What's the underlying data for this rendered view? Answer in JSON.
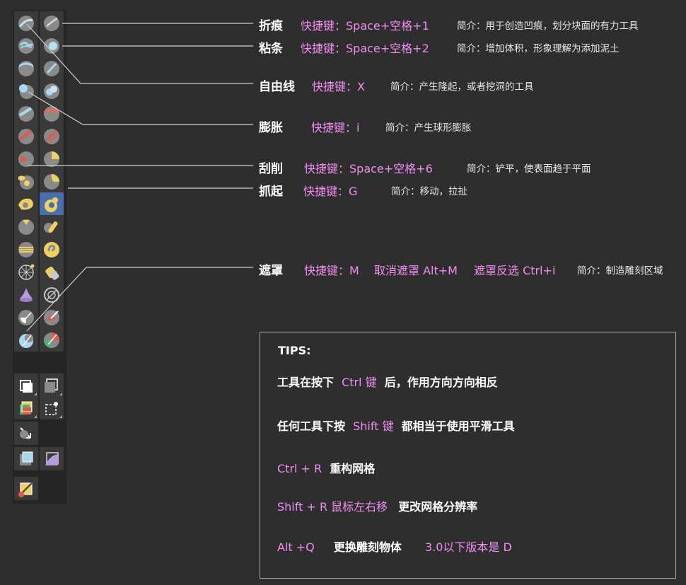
{
  "tools": [
    {
      "name": "折痕",
      "shortcut": "快捷键：Space+空格+1",
      "desc": "简介：用于创造凹痕，划分块面的有力工具"
    },
    {
      "name": "粘条",
      "shortcut": "快捷键：Space+空格+2",
      "desc": "简介：增加体积，形象理解为添加泥土"
    },
    {
      "name": "自由线",
      "shortcut": "快捷键：X",
      "desc": "简介：产生隆起，或者挖洞的工具"
    },
    {
      "name": "膨胀",
      "shortcut": "快捷键：i",
      "desc": "简介：产生球形膨胀"
    },
    {
      "name": "刮削",
      "shortcut": "快捷键：Space+空格+6",
      "desc": "简介：铲平，使表面趋于平面"
    },
    {
      "name": "抓起",
      "shortcut": "快捷键：G",
      "desc": "简介：移动，拉扯"
    },
    {
      "name": "遮罩",
      "shortcut": "快捷键：M",
      "shortcut2": "取消遮罩 Alt+M",
      "shortcut3": "遮罩反选 Ctrl+i",
      "desc": "简介：制造雕刻区域"
    }
  ],
  "tips": {
    "title": "TIPS:",
    "tip1": {
      "a": "工具在按下",
      "b": "Ctrl 键",
      "c": "后，作用方向方向相反"
    },
    "tip2": {
      "a": "任何工具下按",
      "b": "Shift 键",
      "c": "都相当于使用平滑工具"
    },
    "tip3": {
      "a": "Ctrl + R",
      "b": "重构网格"
    },
    "tip4": {
      "a": "Shift + R 鼠标左右移",
      "b": "更改网格分辨率"
    },
    "tip5": {
      "a": "Alt +Q",
      "b": "更换雕刻物体",
      "c": "3.0以下版本是  D"
    }
  },
  "colors": {
    "background": "#2e2e2e",
    "palette": "#252525",
    "button": "#3a3a3a",
    "active_button": "#4a6fb0",
    "accent_pink": "#f08ef0",
    "text": "#ffffff"
  },
  "icons": [
    "crease-brush-icon",
    "blob-brush-icon",
    "draw-brush-icon",
    "clay-strips-icon",
    "stamp-brush-icon",
    "inflate-brush-icon",
    "crease-blue-icon",
    "clay-red-icon",
    "flatten-red-icon",
    "layer-brush-icon",
    "scrape-brush-icon",
    "pinch-brush-icon",
    "snake-hook-icon",
    "grab-brush-icon",
    "thumb-brush-icon",
    "grab-yellow-icon",
    "nudge-brush-icon",
    "smooth-brush-icon",
    "rotate-brush-icon",
    "slide-relax-icon",
    "pose-brush-icon",
    "boundary-brush-icon",
    "cloth-brush-icon",
    "simplify-brush-icon",
    "mask-brush-icon",
    "draw-face-sets-icon",
    "multires-brush-icon",
    "mask-red-icon",
    "box-mask-icon",
    "box-face-sets-icon",
    "lasso-trim-icon",
    "box-hide-icon",
    "line-project-icon",
    "mesh-filter-icon",
    "cloth-filter-icon",
    "edit-face-set-icon",
    "transform-icon"
  ]
}
